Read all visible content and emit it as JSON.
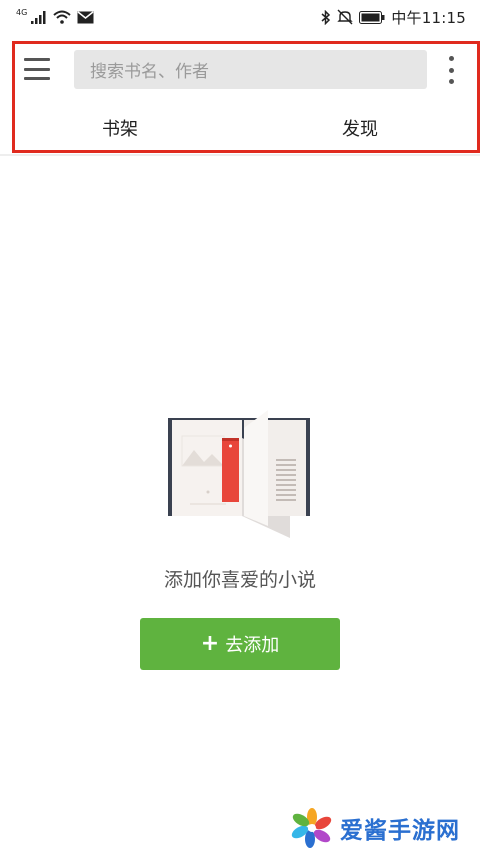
{
  "status_bar": {
    "network_type": "4G",
    "time": "中午11:15",
    "icons": [
      "signal-icon",
      "wifi-icon",
      "mail-icon",
      "bluetooth-icon",
      "mute-icon",
      "battery-icon"
    ]
  },
  "header": {
    "search_placeholder": "搜索书名、作者",
    "tabs": [
      {
        "label": "书架"
      },
      {
        "label": "发现"
      }
    ]
  },
  "empty_state": {
    "message": "添加你喜爱的小说",
    "add_button_label": "去添加",
    "add_button_icon": "plus-icon"
  },
  "watermark": {
    "text": "爱酱手游网"
  },
  "colors": {
    "accent_green": "#5fb33f",
    "highlight_red": "#e02a1e",
    "bookmark_red": "#e8463b"
  }
}
